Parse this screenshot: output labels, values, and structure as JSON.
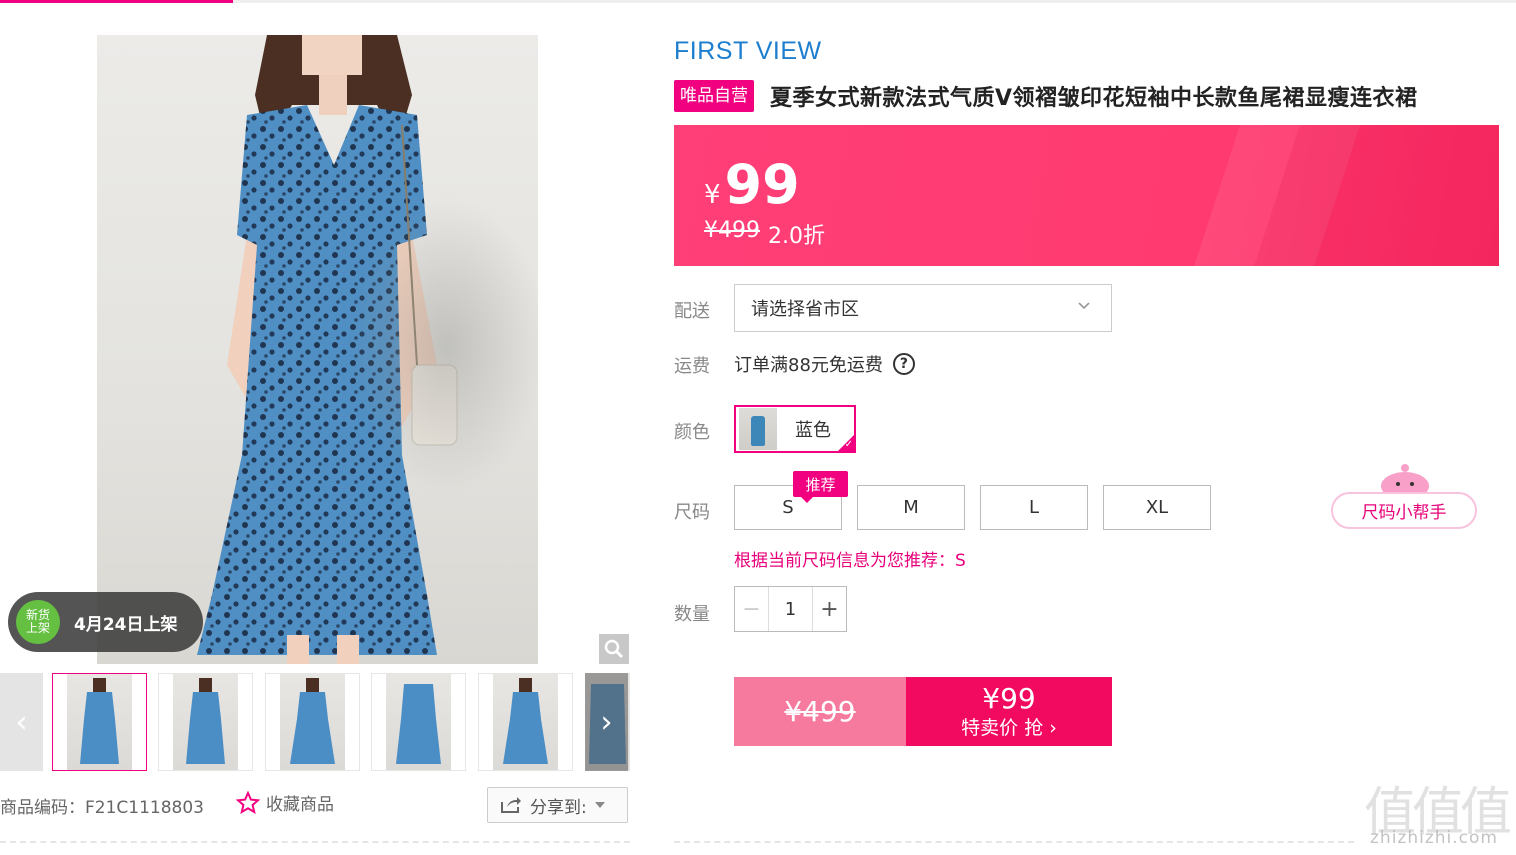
{
  "gallery": {
    "new_badge_line1": "新货",
    "new_badge_line2": "上架",
    "new_badge_date": "4月24日上架",
    "prev_arrow": "‹",
    "next_arrow": "›",
    "thumb_count": 6
  },
  "meta": {
    "product_code": "商品编码：F21C1118803",
    "favorite_label": "收藏商品",
    "share_label": "分享到:"
  },
  "product": {
    "brand": "FIRST VIEW",
    "self_tag": "唯品自营",
    "title": "夏季女式新款法式气质V领褶皱印花短袖中长款鱼尾裙显瘦连衣裙"
  },
  "price": {
    "currency": "¥",
    "current": "99",
    "original": "¥499",
    "discount": "2.0折"
  },
  "delivery": {
    "label": "配送",
    "placeholder": "请选择省市区"
  },
  "shipping": {
    "label": "运费",
    "text": "订单满88元免运费",
    "help": "?"
  },
  "color": {
    "label": "颜色",
    "selected": "蓝色"
  },
  "size": {
    "label": "尺码",
    "recommend_tag": "推荐",
    "options": [
      "S",
      "M",
      "L",
      "XL"
    ],
    "helper": "尺码小帮手",
    "recommend_text": "根据当前尺码信息为您推荐：S"
  },
  "quantity": {
    "label": "数量",
    "minus": "−",
    "value": "1",
    "plus": "+"
  },
  "buy": {
    "original": "¥499",
    "price": "¥99",
    "action": "特卖价 抢 ›"
  },
  "watermark": {
    "big": "值值值",
    "small": "zhizhizhi.com"
  },
  "colors": {
    "accent": "#f10180",
    "banner": "#ff3a70",
    "brand_blue": "#1d7ecf",
    "buy_left": "#f6799e",
    "buy_right": "#f10a5f"
  }
}
